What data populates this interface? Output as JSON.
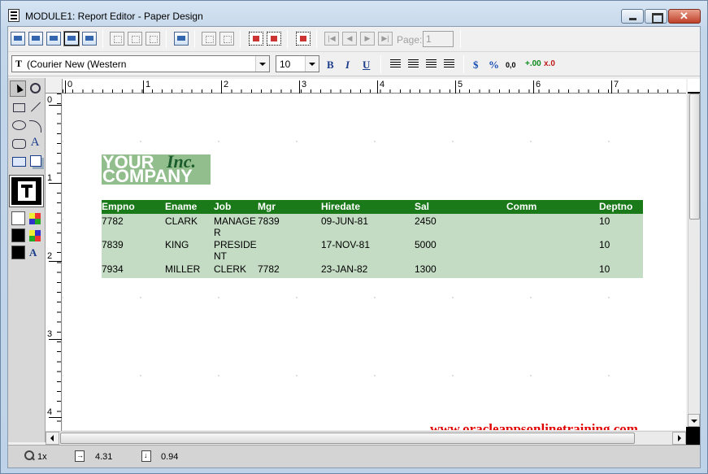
{
  "window": {
    "title": "MODULE1: Report Editor - Paper Design"
  },
  "toolbar": {
    "page_label": "Page:",
    "page_value": "1"
  },
  "font_bar": {
    "font_name": "(Courier New (Western",
    "font_size": "10",
    "bold": "B",
    "italic": "I",
    "underline": "U",
    "currency": "$",
    "percent": "%",
    "commas": "0,0",
    "add_decimal": "+.00",
    "remove_decimal": "x.0"
  },
  "tools": {
    "text_label": "A",
    "text_color_label": "A"
  },
  "ruler": {
    "h_marks": [
      "0",
      "1",
      "2",
      "3",
      "4",
      "5",
      "6",
      "7"
    ],
    "v_marks": [
      "0",
      "1",
      "2",
      "3",
      "4"
    ]
  },
  "logo": {
    "your": "YOUR",
    "inc": "Inc.",
    "company": "COMPANY"
  },
  "report": {
    "columns": [
      "Empno",
      "Ename",
      "Job",
      "Mgr",
      "Hiredate",
      "Sal",
      "Comm",
      "Deptno"
    ],
    "rows": [
      {
        "empno": "7782",
        "ename": "CLARK",
        "job1": "MANAGE",
        "job2": "R",
        "mgr": "7839",
        "hiredate": "09-JUN-81",
        "sal": "2450",
        "comm": "",
        "deptno": "10"
      },
      {
        "empno": "7839",
        "ename": "KING",
        "job1": "PRESIDE",
        "job2": "NT",
        "mgr": "",
        "hiredate": "17-NOV-81",
        "sal": "5000",
        "comm": "",
        "deptno": "10"
      },
      {
        "empno": "7934",
        "ename": "MILLER",
        "job1": "CLERK",
        "job2": "",
        "mgr": "7782",
        "hiredate": "23-JAN-82",
        "sal": "1300",
        "comm": "",
        "deptno": "10"
      }
    ]
  },
  "watermark": "www.oracleappsonlinetraining.com",
  "status": {
    "zoom": "1x",
    "x": "4.31",
    "y": "0.94"
  },
  "colors": {
    "header_bg": "#1a7a1a",
    "body_bg": "#c4dbc4",
    "logo_bg": "#92be8e",
    "watermark": "#e00000"
  }
}
